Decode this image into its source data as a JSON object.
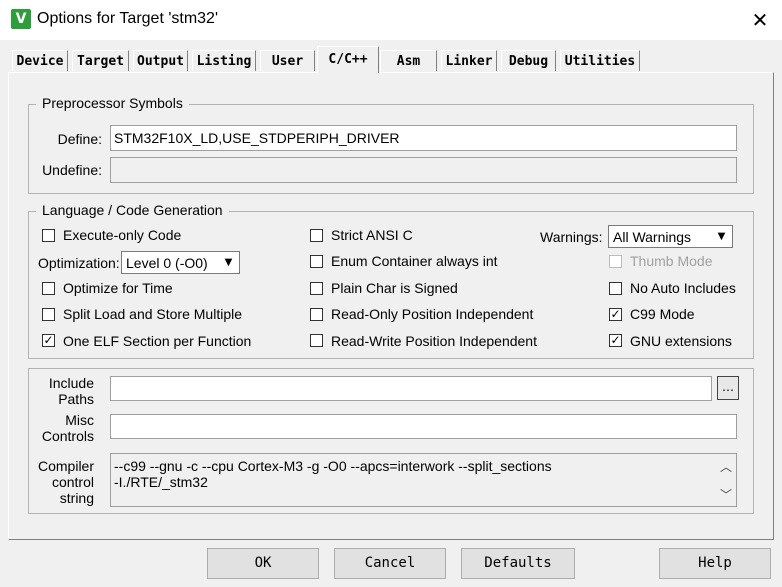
{
  "window": {
    "title": "Options for Target 'stm32'",
    "close_glyph": "✕",
    "icon_glyph": "V"
  },
  "tabs": [
    {
      "label": "Device"
    },
    {
      "label": "Target"
    },
    {
      "label": "Output"
    },
    {
      "label": "Listing"
    },
    {
      "label": "User"
    },
    {
      "label": "C/C++",
      "active": true
    },
    {
      "label": "Asm"
    },
    {
      "label": "Linker"
    },
    {
      "label": "Debug"
    },
    {
      "label": "Utilities"
    }
  ],
  "preprocessor": {
    "group_label": "Preprocessor Symbols",
    "define_label": "Define:",
    "define_value": "STM32F10X_LD,USE_STDPERIPH_DRIVER",
    "undefine_label": "Undefine:",
    "undefine_value": ""
  },
  "language": {
    "group_label": "Language / Code Generation",
    "execute_only": {
      "label": "Execute-only Code",
      "checked": false
    },
    "optimization_label": "Optimization:",
    "optimization_value": "Level 0 (-O0)",
    "optimize_time": {
      "label": "Optimize for Time",
      "checked": false
    },
    "split_load": {
      "label": "Split Load and Store Multiple",
      "checked": false
    },
    "one_elf": {
      "label": "One ELF Section per Function",
      "checked": true
    },
    "strict_ansi": {
      "label": "Strict ANSI C",
      "checked": false
    },
    "enum_container": {
      "label": "Enum Container always int",
      "checked": false
    },
    "plain_char": {
      "label": "Plain Char is Signed",
      "checked": false
    },
    "ro_pi": {
      "label": "Read-Only Position Independent",
      "checked": false
    },
    "rw_pi": {
      "label": "Read-Write Position Independent",
      "checked": false
    },
    "warnings_label": "Warnings:",
    "warnings_value": "All Warnings",
    "thumb_mode": {
      "label": "Thumb Mode",
      "checked": false,
      "disabled": true
    },
    "no_auto_includes": {
      "label": "No Auto Includes",
      "checked": false
    },
    "c99_mode": {
      "label": "C99 Mode",
      "checked": true
    },
    "gnu_extensions": {
      "label": "GNU extensions",
      "checked": true
    }
  },
  "include_paths": {
    "label_line1": "Include",
    "label_line2": "Paths",
    "value": "",
    "browse_glyph": "…"
  },
  "misc_controls": {
    "label_line1": "Misc",
    "label_line2": "Controls",
    "value": ""
  },
  "compiler_control": {
    "label_line1": "Compiler",
    "label_line2": "control",
    "label_line3": "string",
    "line1": "--c99 --gnu -c --cpu Cortex-M3 -g -O0 --apcs=interwork --split_sections",
    "line2": "-I./RTE/_stm32"
  },
  "buttons": {
    "ok": "OK",
    "cancel": "Cancel",
    "defaults": "Defaults",
    "help": "Help"
  },
  "check_glyph": "✓"
}
